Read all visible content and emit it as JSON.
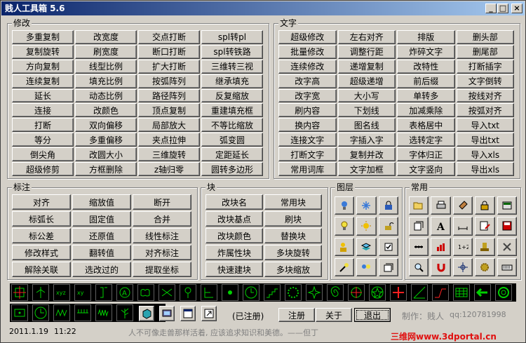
{
  "window": {
    "title": "贱人工具箱 5.6",
    "min": "_",
    "max": "□",
    "close": "×"
  },
  "groups": {
    "modify": {
      "label": "修改",
      "rows": [
        [
          "多重复制",
          "改宽度",
          "交点打断",
          "spl转pl"
        ],
        [
          "复制旋转",
          "刷宽度",
          "断口打断",
          "spl转铁路"
        ],
        [
          "方向复制",
          "线型比例",
          "扩大打断",
          "三维转三视"
        ],
        [
          "连续复制",
          "填充比例",
          "按弧阵列",
          "继承填充"
        ],
        [
          "延长",
          "动态比例",
          "路径阵列",
          "反复缩放"
        ],
        [
          "连接",
          "改颜色",
          "顶点复制",
          "重建填充框"
        ],
        [
          "打断",
          "双向偏移",
          "局部放大",
          "不等比缩放"
        ],
        [
          "等分",
          "多重偏移",
          "夹点拉伸",
          "弧变圆"
        ],
        [
          "倒尖角",
          "改圆大小",
          "三维旋转",
          "定距延长"
        ],
        [
          "超级修剪",
          "方框删除",
          "z轴归零",
          "圆转多边形"
        ]
      ]
    },
    "text": {
      "label": "文字",
      "rows": [
        [
          "超级修改",
          "左右对齐",
          "排版",
          "删头部"
        ],
        [
          "批量修改",
          "调整行距",
          "炸碎文字",
          "删尾部"
        ],
        [
          "连续修改",
          "递增复制",
          "改特性",
          "打断插字"
        ],
        [
          "改字高",
          "超级递增",
          "前后缀",
          "文字倒转"
        ],
        [
          "改字宽",
          "大小写",
          "单转多",
          "按线对齐"
        ],
        [
          "刷内容",
          "下划线",
          "加减乘除",
          "按弧对齐"
        ],
        [
          "换内容",
          "图名线",
          "表格居中",
          "导入txt"
        ],
        [
          "连接文字",
          "字插入字",
          "选转定字",
          "导出txt"
        ],
        [
          "打断文字",
          "复制并改",
          "字体归正",
          "导入xls"
        ],
        [
          "常用词库",
          "文字加框",
          "文字竖向",
          "导出xls"
        ]
      ]
    },
    "dim": {
      "label": "标注",
      "rows": [
        [
          "对齐",
          "缩放值",
          "断开"
        ],
        [
          "标弧长",
          "固定值",
          "合并"
        ],
        [
          "标公差",
          "还原值",
          "线性标注"
        ],
        [
          "修改样式",
          "翻转值",
          "对齐标注"
        ],
        [
          "解除关联",
          "选改过的",
          "提取坐标"
        ]
      ]
    },
    "block": {
      "label": "块",
      "rows": [
        [
          "改块名",
          "常用块"
        ],
        [
          "改块基点",
          "刷块"
        ],
        [
          "改块颜色",
          "替换块"
        ],
        [
          "炸属性块",
          "多块旋转"
        ],
        [
          "快速建块",
          "多块缩放"
        ]
      ]
    },
    "layer": {
      "label": "图层"
    },
    "common": {
      "label": "常用"
    }
  },
  "layer_icons": [
    "bulb-blue-icon",
    "snowflake-icon",
    "lock-blue-icon",
    "bulb-yellow-icon",
    "sun-icon",
    "unlock-icon",
    "people-layer-icon",
    "layers-stack-icon",
    "checkbox-icon",
    "hand-bulb-icon",
    "bulbs-pair-icon",
    "layer-sheets-icon"
  ],
  "common_icons": [
    "open-folder-icon",
    "printer-icon",
    "brush-icon",
    "padlock-icon",
    "calculator-icon",
    "papers-icon",
    "font-a-icon",
    "dimension-icon",
    "doc-pen-icon",
    "save-disk-icon",
    "ruler-line-icon",
    "bar-chart-icon",
    "number-icon",
    "stamp-icon",
    "tools-icon",
    "magnifier-icon",
    "magnet-icon",
    "snap-point-icon",
    "gear-icon",
    "keyboard-icon"
  ],
  "bottom": {
    "registered": "(已注册)",
    "register_btn": "注册",
    "about_btn": "关于",
    "exit_btn": "退出",
    "author": "制作：贱人",
    "qq": "qq:120781998",
    "date": "2011.1.19",
    "time": "11:22",
    "motto": "人不可像走兽那样活着, 应该追求知识和美德。——但丁",
    "watermark": "三维网www.3dportal.cn"
  },
  "colors": {
    "titlebar": "#0a246a",
    "bar_bg": "#000000",
    "icon_green": "#00d000",
    "watermark": "#e01010"
  }
}
